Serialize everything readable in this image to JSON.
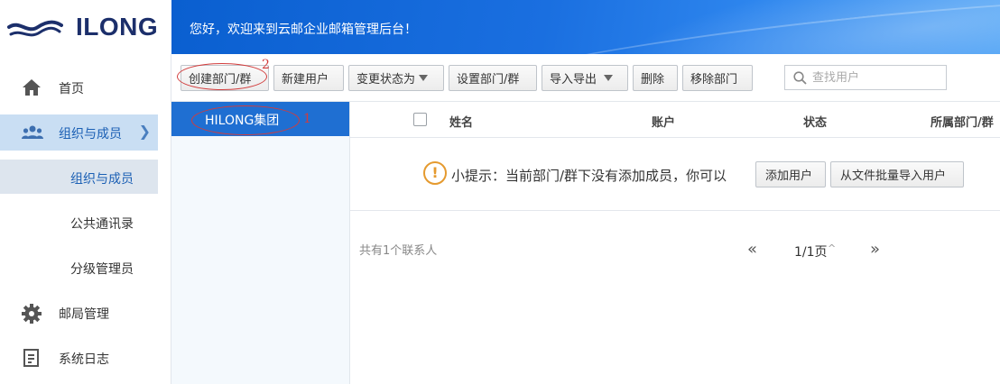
{
  "brand": {
    "logo_text": "ILONG",
    "welcome": "您好，欢迎来到云邮企业邮箱管理后台！"
  },
  "sidebar": {
    "items": [
      {
        "label": "首页",
        "icon": "home-icon"
      },
      {
        "label": "组织与成员",
        "icon": "users-icon",
        "active": true
      },
      {
        "label": "组织与成员",
        "sub": true,
        "active": true
      },
      {
        "label": "公共通讯录",
        "sub": true
      },
      {
        "label": "分级管理员",
        "sub": true
      },
      {
        "label": "邮局管理",
        "icon": "gear-icon"
      },
      {
        "label": "系统日志",
        "icon": "log-icon"
      }
    ]
  },
  "toolbar": {
    "create_dept": "创建部门/群",
    "new_user": "新建用户",
    "change_status": "变更状态为",
    "set_dept": "设置部门/群",
    "import_export": "导入导出",
    "delete": "删除",
    "remove_dept": "移除部门",
    "search_placeholder": "查找用户"
  },
  "annotations": {
    "one": "1",
    "two": "2"
  },
  "tree": {
    "node": "HILONG集团"
  },
  "table": {
    "columns": [
      "姓名",
      "账户",
      "状态",
      "所属部门/群"
    ],
    "tip": "小提示：当前部门/群下没有添加成员，你可以",
    "tip_icon": "!",
    "add_user": "添加用户",
    "batch_import": "从文件批量导入用户"
  },
  "footer": {
    "count": "共有1个联系人",
    "prev": "«",
    "page_info": "1/1页",
    "page_caret": "^",
    "next": "»"
  },
  "colors": {
    "banner": "#1a6fe0",
    "active_node": "#1f6fd2",
    "sidebar_active": "#c9def3",
    "annotation": "#d23c3c",
    "tip_icon": "#e59a2f"
  }
}
